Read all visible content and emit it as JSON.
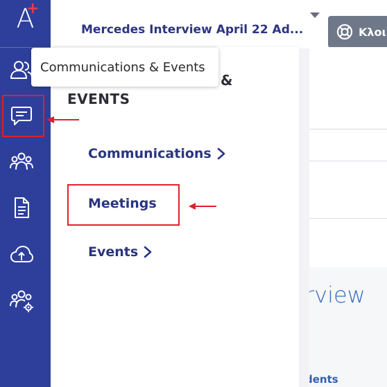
{
  "app": {
    "logo_letter": "A",
    "logo_plus": "+"
  },
  "header": {
    "title": "Mercedes Interview April 22 Ad...",
    "action_button_label": "Κλοι"
  },
  "tooltip": {
    "text": "Communications & Events"
  },
  "flyout": {
    "title_line1": "&",
    "title_line2": "EVENTS",
    "items": [
      {
        "label": "Communications",
        "has_chevron": true
      },
      {
        "label": "Meetings",
        "has_chevron": false
      },
      {
        "label": "Events",
        "has_chevron": true
      }
    ]
  },
  "background": {
    "big_text": "rview",
    "small_text": "dents"
  },
  "rail": {
    "items": [
      {
        "icon": "user-group-icon"
      },
      {
        "icon": "message-icon"
      },
      {
        "icon": "team-icon"
      },
      {
        "icon": "document-icon"
      },
      {
        "icon": "cloud-upload-icon"
      },
      {
        "icon": "team-settings-icon"
      }
    ]
  },
  "colors": {
    "rail_bg": "#2e3f9b",
    "menu_text": "#2a3580",
    "annotation_red": "#e0202b",
    "logo_plus": "#e63b4e"
  }
}
